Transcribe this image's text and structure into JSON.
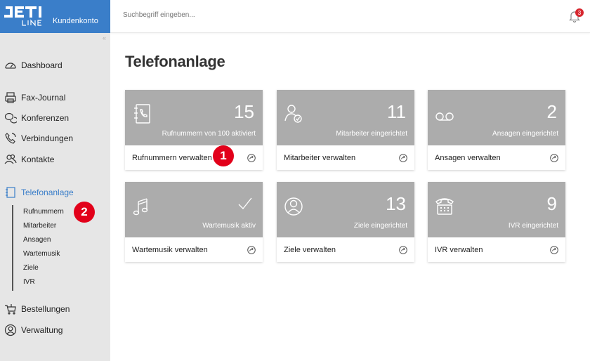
{
  "brand": {
    "logo_text": "JETI LINE",
    "label": "Kundenkonto"
  },
  "search": {
    "placeholder": "Suchbegriff eingeben..."
  },
  "notifications": {
    "count": "3"
  },
  "sidebar": {
    "items": [
      {
        "label": "Dashboard",
        "icon": "dashboard-icon"
      },
      {
        "label": "Fax-Journal",
        "icon": "fax-icon"
      },
      {
        "label": "Konferenzen",
        "icon": "chat-icon"
      },
      {
        "label": "Verbindungen",
        "icon": "phone-icon"
      },
      {
        "label": "Kontakte",
        "icon": "contacts-icon"
      },
      {
        "label": "Telefonanlage",
        "icon": "phonebook-icon"
      },
      {
        "label": "Bestellungen",
        "icon": "cart-icon"
      },
      {
        "label": "Verwaltung",
        "icon": "user-circle-icon"
      }
    ],
    "subitems": [
      "Rufnummern",
      "Mitarbeiter",
      "Ansagen",
      "Wartemusik",
      "Ziele",
      "IVR"
    ]
  },
  "annotations": {
    "marker1": "1",
    "marker2": "2"
  },
  "page_title": "Telefonanlage",
  "cards": [
    {
      "num": "15",
      "desc": "Rufnummern von 100 aktiviert",
      "action": "Rufnummern verwalten",
      "icon": "phonebook-icon"
    },
    {
      "num": "11",
      "desc": "Mitarbeiter eingerichtet",
      "action": "Mitarbeiter verwalten",
      "icon": "user-check-icon"
    },
    {
      "num": "2",
      "desc": "Ansagen eingerichtet",
      "action": "Ansagen verwalten",
      "icon": "voicemail-icon"
    },
    {
      "num": "",
      "desc": "Wartemusik aktiv",
      "action": "Wartemusik verwalten",
      "icon": "music-icon"
    },
    {
      "num": "13",
      "desc": "Ziele eingerichtet",
      "action": "Ziele verwalten",
      "icon": "user-circle-icon"
    },
    {
      "num": "9",
      "desc": "IVR eingerichtet",
      "action": "IVR verwalten",
      "icon": "desk-phone-icon"
    }
  ],
  "colors": {
    "brand": "#3a7ec9",
    "card_header": "#acacac",
    "marker": "#e2001a",
    "sidebar_bg": "#e6e6e6"
  }
}
